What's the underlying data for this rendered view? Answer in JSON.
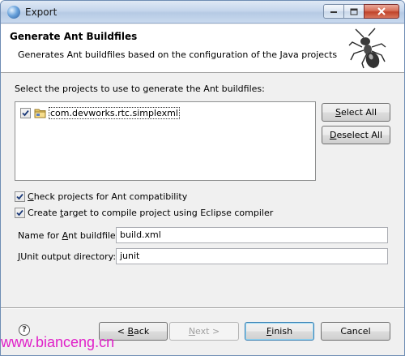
{
  "window": {
    "title": "Export"
  },
  "banner": {
    "title": "Generate Ant Buildfiles",
    "description": "Generates Ant buildfiles based on the configuration of the Java projects"
  },
  "projects": {
    "label": "Select the projects to use to generate the Ant buildfiles:",
    "items": [
      {
        "name": "com.devworks.rtc.simplexml",
        "checked": true
      }
    ]
  },
  "buttons": {
    "select_all_mnemonic": "S",
    "select_all_rest": "elect All",
    "deselect_all_mnemonic": "D",
    "deselect_all_rest": "eselect All",
    "back_prefix": "< ",
    "back_mnemonic": "B",
    "back_rest": "ack",
    "next_prefix": "",
    "next_mnemonic": "N",
    "next_rest": "ext >",
    "finish_mnemonic": "F",
    "finish_rest": "inish",
    "cancel": "Cancel"
  },
  "options": {
    "check_compat": {
      "mnemonic": "C",
      "rest": "heck projects for Ant compatibility",
      "checked": true
    },
    "create_target": {
      "pre": "Create ",
      "mnemonic": "t",
      "rest": "arget to compile project using Eclipse compiler",
      "checked": true
    }
  },
  "fields": {
    "buildfile": {
      "label_pre": "Name for ",
      "label_mnemonic": "A",
      "label_rest": "nt buildfile:",
      "value": "build.xml"
    },
    "junit": {
      "label_mnemonic": "J",
      "label_rest": "Unit output directory:",
      "value": "junit"
    }
  },
  "help": {
    "glyph": "?"
  },
  "watermark": "www.bianceng.cn"
}
